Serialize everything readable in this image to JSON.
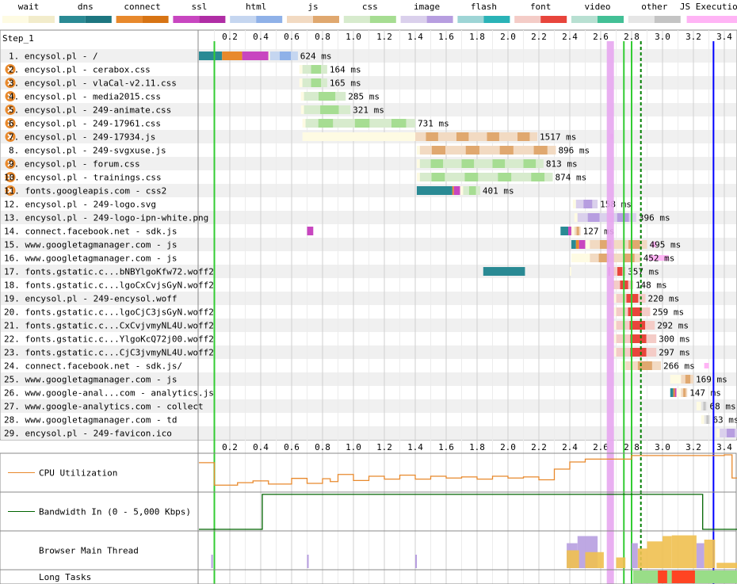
{
  "legend": [
    {
      "label": "wait",
      "color": "#fefbe3",
      "dark": "#f2eccb"
    },
    {
      "label": "dns",
      "color": "#2a8a94",
      "dark": "#1d7680"
    },
    {
      "label": "connect",
      "color": "#e8892c",
      "dark": "#d77414"
    },
    {
      "label": "ssl",
      "color": "#c846c0",
      "dark": "#b02da5"
    },
    {
      "label": "html",
      "color": "#c5d6f0",
      "dark": "#8fb1e8"
    },
    {
      "label": "js",
      "color": "#f2dac2",
      "dark": "#e0a86f"
    },
    {
      "label": "css",
      "color": "#d7ebcd",
      "dark": "#a6dd92"
    },
    {
      "label": "image",
      "color": "#dad0ec",
      "dark": "#b79ee0"
    },
    {
      "label": "flash",
      "color": "#9ed5d6",
      "dark": "#2ab3b7"
    },
    {
      "label": "font",
      "color": "#f4ccc7",
      "dark": "#e8453c"
    },
    {
      "label": "video",
      "color": "#b8e0d2",
      "dark": "#43c096"
    },
    {
      "label": "other",
      "color": "#e6e6e6",
      "dark": "#c4c4c4"
    },
    {
      "label": "JS Execution",
      "color": "#ffb4f5",
      "dark": "#ffb4f5"
    }
  ],
  "step_label": "Step_1",
  "chart_data": {
    "type": "waterfall",
    "x_unit": "seconds",
    "xlim": [
      0,
      3.5
    ],
    "x_ticks": [
      "0.2",
      "0.4",
      "0.6",
      "0.8",
      "1.0",
      "1.2",
      "1.4",
      "1.6",
      "1.8",
      "2.0",
      "2.2",
      "2.4",
      "2.6",
      "2.8",
      "3.0",
      "3.2",
      "3.4"
    ],
    "markers": [
      {
        "t": 0.1,
        "color": "#33cc33",
        "style": "solid"
      },
      {
        "t": 2.66,
        "color": "#e7a6f0",
        "style": "band"
      },
      {
        "t": 2.75,
        "color": "#33cc33",
        "style": "solid"
      },
      {
        "t": 2.8,
        "color": "#33cc33",
        "style": "solid"
      },
      {
        "t": 2.86,
        "color": "#008000",
        "style": "dashed"
      },
      {
        "t": 3.33,
        "color": "#0000ff",
        "style": "solid"
      }
    ],
    "requests": [
      {
        "label": "1. encysol.pl - /",
        "ms": "624 ms",
        "type": "html",
        "warn": false,
        "phases": [
          [
            "dns",
            0,
            0.15
          ],
          [
            "connect",
            0.15,
            0.28
          ],
          [
            "ssl",
            0.28,
            0.45
          ],
          [
            "wait",
            0.45,
            0.46
          ],
          [
            "html",
            0.46,
            0.64
          ]
        ],
        "dl": [
          0.46,
          0.64
        ],
        "js": []
      },
      {
        "label": "2. encysol.pl - cerabox.css",
        "ms": "164 ms",
        "type": "css",
        "warn": true,
        "phases": [
          [
            "wait",
            0.65,
            0.67
          ]
        ],
        "dl": [
          0.67,
          0.83
        ],
        "js": []
      },
      {
        "label": "3. encysol.pl - vlaCal-v2.11.css",
        "ms": "165 ms",
        "type": "css",
        "warn": true,
        "phases": [
          [
            "wait",
            0.65,
            0.67
          ]
        ],
        "dl": [
          0.67,
          0.83
        ],
        "js": []
      },
      {
        "label": "4. encysol.pl - media2015.css",
        "ms": "285 ms",
        "type": "css",
        "warn": true,
        "phases": [
          [
            "wait",
            0.66,
            0.68
          ]
        ],
        "dl": [
          0.68,
          0.95
        ],
        "js": []
      },
      {
        "label": "5. encysol.pl - 249-animate.css",
        "ms": "321 ms",
        "type": "css",
        "warn": true,
        "phases": [
          [
            "wait",
            0.66,
            0.68
          ]
        ],
        "dl": [
          0.68,
          0.98
        ],
        "js": []
      },
      {
        "label": "6. encysol.pl - 249-17961.css",
        "ms": "731 ms",
        "type": "css",
        "warn": true,
        "phases": [
          [
            "wait",
            0.67,
            0.69
          ]
        ],
        "dl": [
          0.69,
          1.4
        ],
        "js": []
      },
      {
        "label": "7. encysol.pl - 249-17934.js",
        "ms": "1517 ms",
        "type": "js",
        "warn": true,
        "phases": [
          [
            "wait",
            0.67,
            1.4
          ]
        ],
        "dl": [
          1.4,
          2.19
        ],
        "js": [
          [
            2.66,
            2.68
          ]
        ]
      },
      {
        "label": "8. encysol.pl - 249-svgxuse.js",
        "ms": "896 ms",
        "type": "js",
        "warn": false,
        "phases": [
          [
            "wait",
            1.41,
            1.43
          ]
        ],
        "dl": [
          1.43,
          2.31
        ],
        "js": []
      },
      {
        "label": "9. encysol.pl - forum.css",
        "ms": "813 ms",
        "type": "css",
        "warn": true,
        "phases": [
          [
            "wait",
            1.41,
            1.43
          ]
        ],
        "dl": [
          1.43,
          2.23
        ],
        "js": []
      },
      {
        "label": "10. encysol.pl - trainings.css",
        "ms": "874 ms",
        "type": "css",
        "warn": true,
        "phases": [
          [
            "wait",
            1.41,
            1.43
          ]
        ],
        "dl": [
          1.43,
          2.29
        ],
        "js": []
      },
      {
        "label": "11. fonts.googleapis.com - css2",
        "ms": "401 ms",
        "type": "css",
        "warn": true,
        "phases": [
          [
            "dns",
            1.41,
            1.64
          ],
          [
            "connect",
            1.64,
            1.65
          ],
          [
            "ssl",
            1.65,
            1.69
          ],
          [
            "wait",
            1.69,
            1.71
          ]
        ],
        "dl": [
          1.71,
          1.82
        ],
        "js": []
      },
      {
        "label": "12. encysol.pl - 249-logo.svg",
        "ms": "158 ms",
        "type": "image",
        "warn": false,
        "phases": [
          [
            "wait",
            2.42,
            2.44
          ]
        ],
        "dl": [
          2.44,
          2.58
        ],
        "js": []
      },
      {
        "label": "13. encysol.pl - 249-logo-ipn-white.png",
        "ms": "396 ms",
        "type": "image",
        "warn": false,
        "phases": [
          [
            "wait",
            2.43,
            2.45
          ]
        ],
        "dl": [
          2.45,
          2.83
        ],
        "js": []
      },
      {
        "label": "14. connect.facebook.net - sdk.js",
        "ms": "127 ms",
        "type": "js",
        "warn": false,
        "phases": [
          [
            "ssl",
            0.7,
            0.74
          ],
          [
            "dns",
            2.34,
            2.39
          ],
          [
            "ssl",
            2.39,
            2.41
          ],
          [
            "wait",
            2.41,
            2.43
          ]
        ],
        "dl": [
          2.43,
          2.47
        ],
        "js": []
      },
      {
        "label": "15. www.googletagmanager.com - js",
        "ms": "495 ms",
        "type": "js",
        "warn": false,
        "phases": [
          [
            "dns",
            2.41,
            2.44
          ],
          [
            "connect",
            2.44,
            2.46
          ],
          [
            "ssl",
            2.46,
            2.5
          ],
          [
            "wait",
            2.5,
            2.53
          ]
        ],
        "dl": [
          2.53,
          2.9
        ],
        "js": [
          [
            2.93,
            2.96
          ]
        ]
      },
      {
        "label": "16. www.googletagmanager.com - js",
        "ms": "452 ms",
        "type": "js",
        "warn": false,
        "phases": [
          [
            "wait",
            2.41,
            2.53
          ]
        ],
        "dl": [
          2.53,
          2.86
        ],
        "js": [
          [
            2.91,
            3.04
          ]
        ]
      },
      {
        "label": "17. fonts.gstatic.c...bNBYlgoKfw72.woff2",
        "ms": "357 ms",
        "type": "font",
        "warn": false,
        "phases": [
          [
            "dns",
            1.84,
            2.11
          ],
          [
            "wait",
            2.4,
            2.41
          ],
          [
            "ssl",
            2.65,
            2.66
          ],
          [
            "wait",
            2.66,
            2.68
          ]
        ],
        "dl": [
          2.68,
          2.76
        ],
        "js": []
      },
      {
        "label": "18. fonts.gstatic.c...lgoCxCvjsGyN.woff2",
        "ms": "148 ms",
        "type": "font",
        "warn": false,
        "phases": [
          [
            "wait",
            2.66,
            2.68
          ]
        ],
        "dl": [
          2.68,
          2.81
        ],
        "js": []
      },
      {
        "label": "19. encysol.pl - 249-encysol.woff",
        "ms": "220 ms",
        "type": "font",
        "warn": false,
        "phases": [
          [
            "wait",
            2.66,
            2.7
          ]
        ],
        "dl": [
          2.7,
          2.89
        ],
        "js": []
      },
      {
        "label": "20. fonts.gstatic.c...lgoCjC3jsGyN.woff2",
        "ms": "259 ms",
        "type": "font",
        "warn": false,
        "phases": [
          [
            "wait",
            2.66,
            2.7
          ]
        ],
        "dl": [
          2.7,
          2.92
        ],
        "js": []
      },
      {
        "label": "21. fonts.gstatic.c...CxCvjvmyNL4U.woff2",
        "ms": "292 ms",
        "type": "font",
        "warn": false,
        "phases": [
          [
            "wait",
            2.66,
            2.7
          ]
        ],
        "dl": [
          2.7,
          2.95
        ],
        "js": []
      },
      {
        "label": "22. fonts.gstatic.c...YlgoKcQ72j00.woff2",
        "ms": "300 ms",
        "type": "font",
        "warn": false,
        "phases": [
          [
            "wait",
            2.66,
            2.7
          ]
        ],
        "dl": [
          2.7,
          2.96
        ],
        "js": []
      },
      {
        "label": "23. fonts.gstatic.c...CjC3jvmyNL4U.woff2",
        "ms": "297 ms",
        "type": "font",
        "warn": false,
        "phases": [
          [
            "wait",
            2.66,
            2.7
          ]
        ],
        "dl": [
          2.7,
          2.96
        ],
        "js": []
      },
      {
        "label": "24. connect.facebook.net - sdk.js/",
        "ms": "266 ms",
        "type": "js",
        "warn": false,
        "phases": [
          [
            "wait",
            2.73,
            2.76
          ]
        ],
        "dl": [
          2.76,
          2.99
        ],
        "js": [
          [
            3.27,
            3.3
          ]
        ]
      },
      {
        "label": "25. www.googletagmanager.com - js",
        "ms": "169 ms",
        "type": "js",
        "warn": false,
        "phases": [
          [
            "wait",
            3.05,
            3.12
          ]
        ],
        "dl": [
          3.12,
          3.2
        ],
        "js": []
      },
      {
        "label": "26. www.google-anal...com - analytics.js",
        "ms": "147 ms",
        "type": "js",
        "warn": false,
        "phases": [
          [
            "dns",
            3.05,
            3.07
          ],
          [
            "connect",
            3.07,
            3.08
          ],
          [
            "ssl",
            3.08,
            3.09
          ],
          [
            "wait",
            3.09,
            3.12
          ]
        ],
        "dl": [
          3.12,
          3.16
        ],
        "js": []
      },
      {
        "label": "27. www.google-analytics.com - collect",
        "ms": "68 ms",
        "type": "other",
        "warn": false,
        "phases": [
          [
            "wait",
            3.22,
            3.25
          ]
        ],
        "dl": [
          3.25,
          3.29
        ],
        "js": []
      },
      {
        "label": "28. www.googletagmanager.com - td",
        "ms": "63 ms",
        "type": "other",
        "warn": false,
        "phases": [
          [
            "wait",
            3.25,
            3.27
          ]
        ],
        "dl": [
          3.27,
          3.31
        ],
        "js": []
      },
      {
        "label": "29. encysol.pl - 249-favicon.ico",
        "ms": "139 ms",
        "type": "image",
        "warn": false,
        "phases": [
          [
            "wait",
            3.35,
            3.37
          ]
        ],
        "dl": [
          3.37,
          3.5
        ],
        "js": []
      }
    ],
    "cpu": {
      "label": "CPU Utilization",
      "values": [
        [
          0,
          78
        ],
        [
          0.1,
          72
        ],
        [
          0.1,
          15
        ],
        [
          0.25,
          22
        ],
        [
          0.35,
          27
        ],
        [
          0.45,
          18
        ],
        [
          0.6,
          34
        ],
        [
          0.7,
          20
        ],
        [
          0.8,
          33
        ],
        [
          0.85,
          25
        ],
        [
          0.9,
          45
        ],
        [
          1.0,
          28
        ],
        [
          1.1,
          40
        ],
        [
          1.2,
          32
        ],
        [
          1.3,
          43
        ],
        [
          1.4,
          32
        ],
        [
          1.5,
          40
        ],
        [
          1.6,
          35
        ],
        [
          1.7,
          38
        ],
        [
          1.8,
          32
        ],
        [
          1.9,
          40
        ],
        [
          2.0,
          35
        ],
        [
          2.1,
          38
        ],
        [
          2.2,
          30
        ],
        [
          2.3,
          60
        ],
        [
          2.4,
          80
        ],
        [
          2.5,
          88
        ],
        [
          2.6,
          88
        ],
        [
          2.8,
          98
        ],
        [
          3.4,
          100
        ],
        [
          3.45,
          35
        ],
        [
          3.5,
          35
        ]
      ]
    },
    "bandwidth": {
      "label": "Bandwidth In (0 - 5,000 Kbps)",
      "values": [
        [
          0,
          0
        ],
        [
          0.41,
          0
        ],
        [
          0.41,
          98
        ],
        [
          3.26,
          98
        ],
        [
          3.26,
          0
        ],
        [
          3.5,
          0
        ]
      ]
    },
    "main_thread": {
      "label": "Browser Main Thread"
    },
    "long_tasks": {
      "label": "Long Tasks",
      "green": [
        2.81,
        3.5
      ],
      "red": [
        [
          2.97,
          3.03
        ],
        [
          3.06,
          3.21
        ]
      ]
    }
  }
}
